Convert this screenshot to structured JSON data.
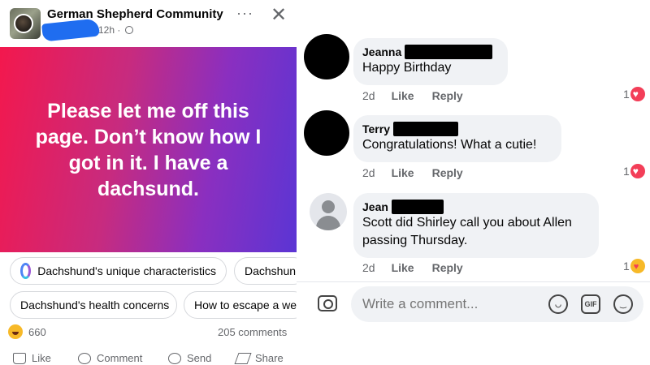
{
  "post": {
    "group_name": "German Shepherd Community",
    "time": "12h ·",
    "more_glyph": "···",
    "close_glyph": "✕",
    "text": "Please let me off this page. Don’t know how I got in it. I have a dachsund.",
    "gradient_colors": [
      "#f3184d",
      "#8a2fc0",
      "#5b35d4"
    ]
  },
  "chips": {
    "row1": [
      "Dachshund's unique characteristics",
      "Dachshun"
    ],
    "row2": [
      "Dachshund's health concerns",
      "How to escape a we"
    ]
  },
  "stats": {
    "reactions": "660",
    "comments": "205 comments"
  },
  "actions": [
    "Like",
    "Comment",
    "Send",
    "Share"
  ],
  "comments": [
    {
      "name": "Jeanna",
      "text": "Happy Birthday",
      "time": "2d",
      "like": "Like",
      "reply": "Reply",
      "reaction_count": "1",
      "reaction": "heart-icon"
    },
    {
      "name": "Terry",
      "text": "Congratulations! What a cutie!",
      "time": "2d",
      "like": "Like",
      "reply": "Reply",
      "reaction_count": "1",
      "reaction": "heart-icon"
    },
    {
      "name": "Jean",
      "text": "Scott did Shirley call you about Allen passing Thursday.",
      "time": "2d",
      "like": "Like",
      "reply": "Reply",
      "reaction_count": "1",
      "reaction": "care-icon"
    }
  ],
  "composer": {
    "placeholder": "Write a comment...",
    "gif_label": "GIF"
  },
  "colors": {
    "heart": "#f33e58",
    "haha": "#f7b928",
    "bubble": "#f0f2f5",
    "meta_text": "#65676b"
  }
}
